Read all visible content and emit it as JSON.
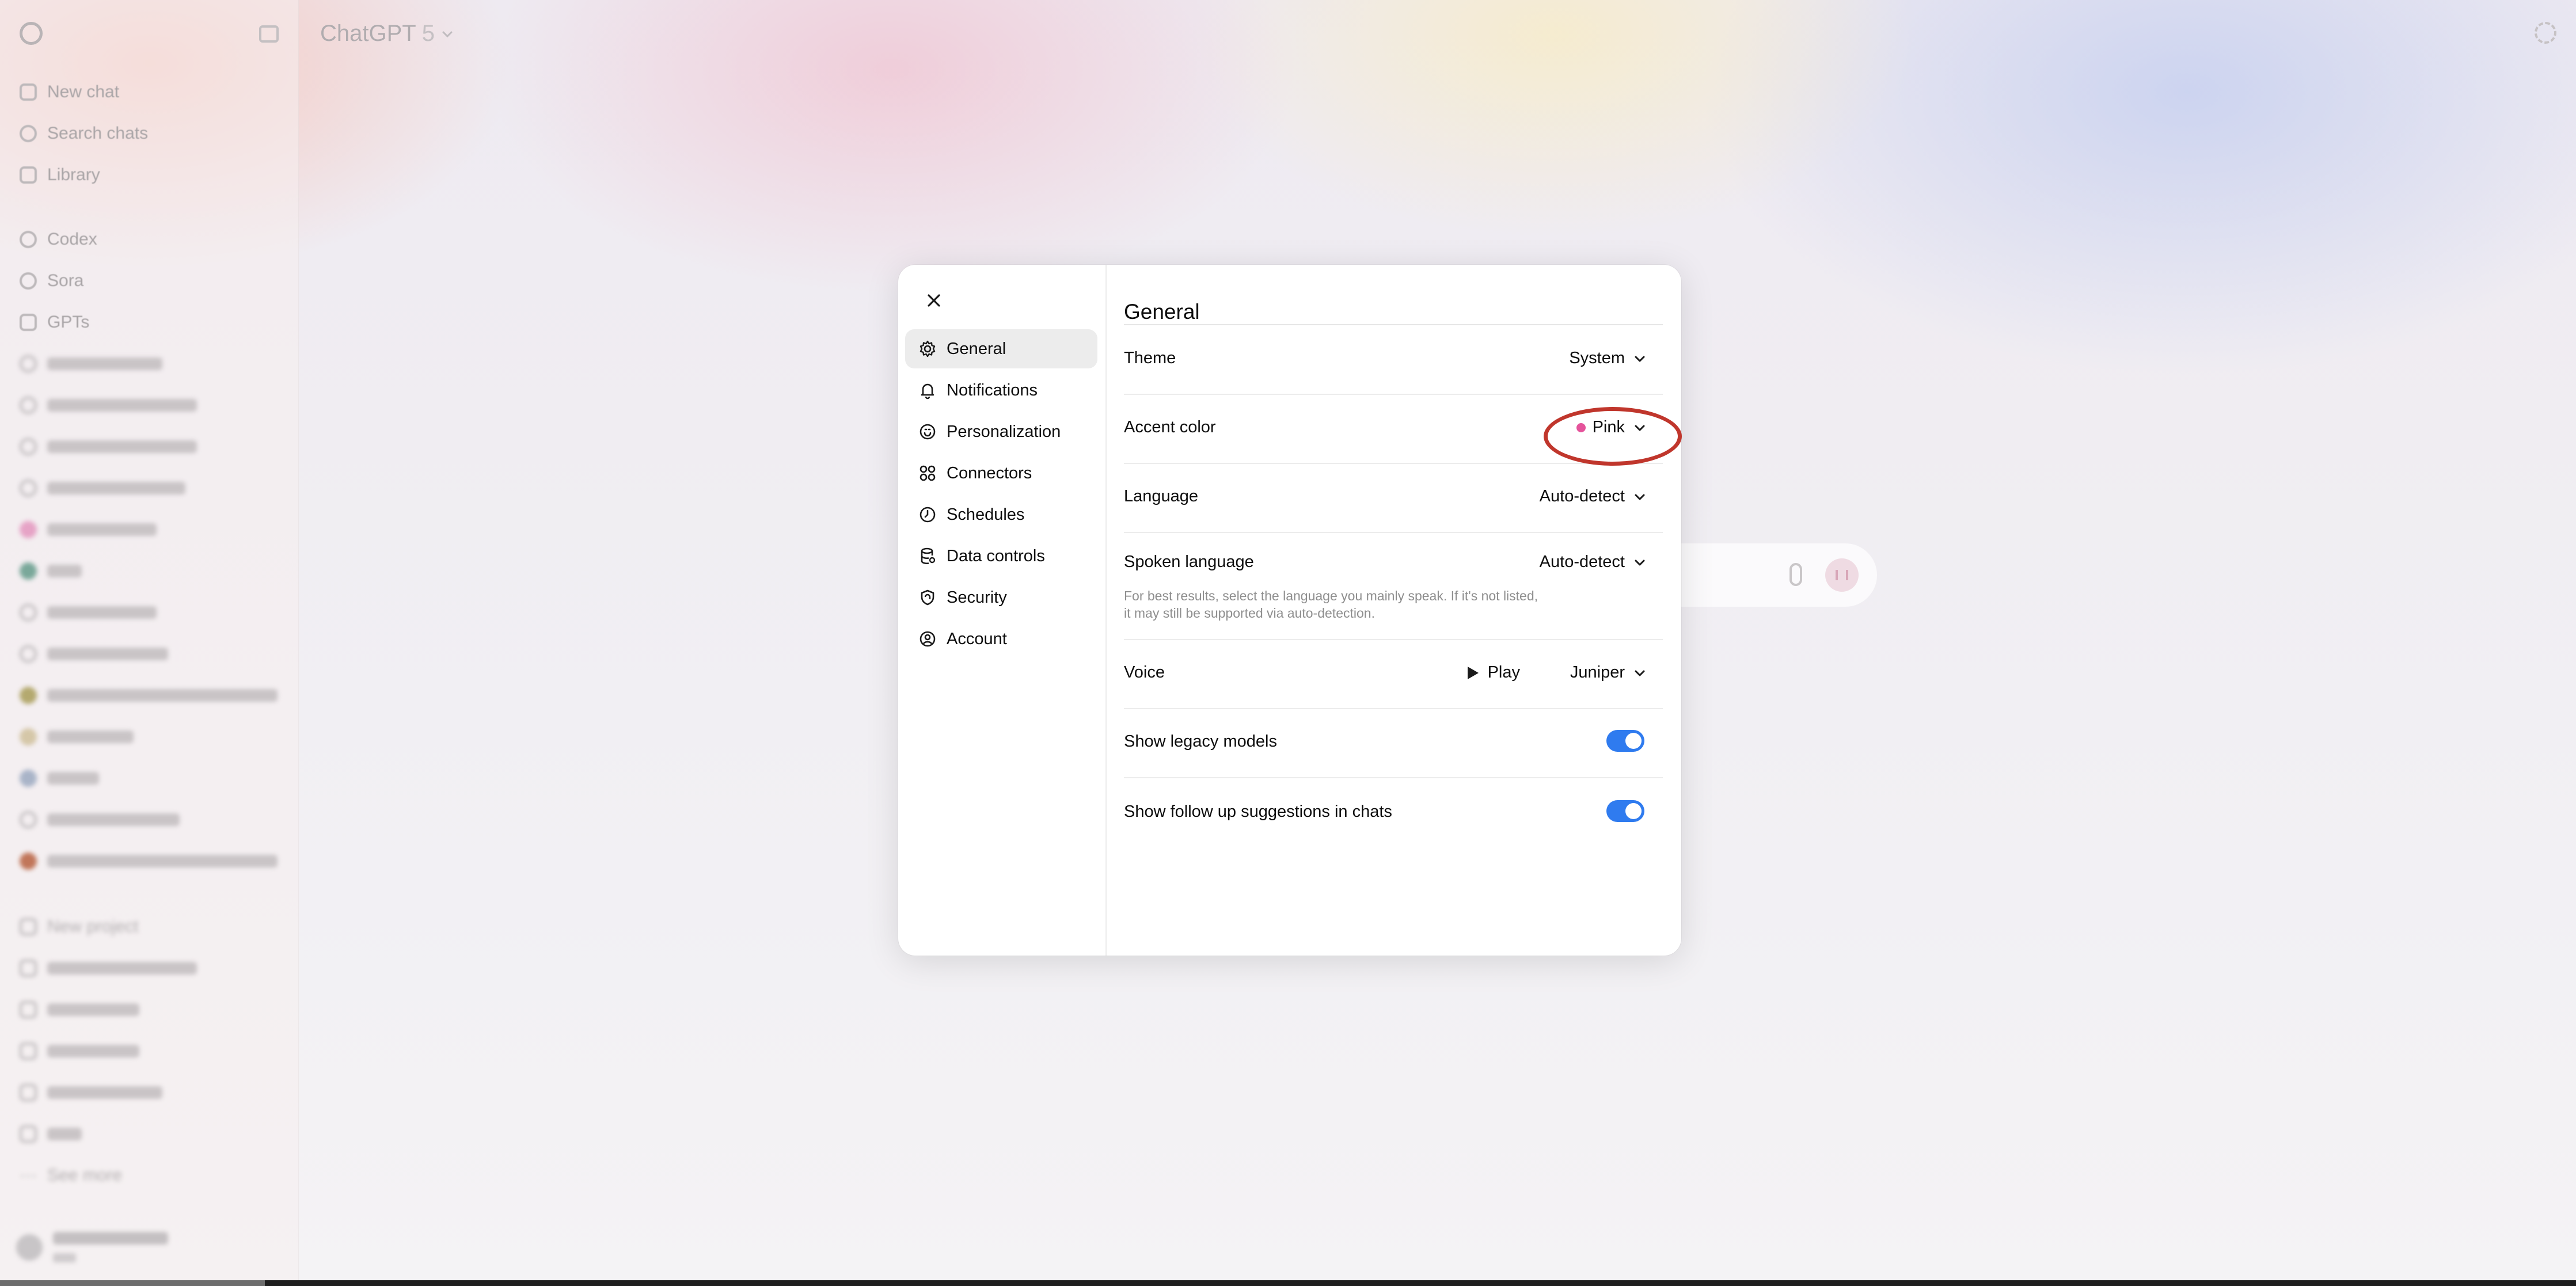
{
  "app": {
    "title": "ChatGPT",
    "model_version": "5"
  },
  "sidebar": {
    "primary": [
      {
        "label": "New chat",
        "icon": "edit-icon"
      },
      {
        "label": "Search chats",
        "icon": "search-icon"
      },
      {
        "label": "Library",
        "icon": "library-icon"
      }
    ],
    "secondary": [
      {
        "label": "Codex",
        "icon": "codex-icon"
      },
      {
        "label": "Sora",
        "icon": "sora-icon"
      },
      {
        "label": "GPTs",
        "icon": "grid-icon"
      }
    ],
    "projects_new_label": "New project",
    "see_more_label": "See more"
  },
  "settings": {
    "nav": [
      {
        "label": "General",
        "icon": "gear-icon",
        "active": true
      },
      {
        "label": "Notifications",
        "icon": "bell-icon"
      },
      {
        "label": "Personalization",
        "icon": "personalization-icon"
      },
      {
        "label": "Connectors",
        "icon": "connectors-icon"
      },
      {
        "label": "Schedules",
        "icon": "clock-icon"
      },
      {
        "label": "Data controls",
        "icon": "database-icon"
      },
      {
        "label": "Security",
        "icon": "shield-icon"
      },
      {
        "label": "Account",
        "icon": "user-circle-icon"
      }
    ],
    "title": "General",
    "theme": {
      "label": "Theme",
      "value": "System"
    },
    "accent_color": {
      "label": "Accent color",
      "value": "Pink",
      "swatch": "#e5539b"
    },
    "language": {
      "label": "Language",
      "value": "Auto-detect"
    },
    "spoken_language": {
      "label": "Spoken language",
      "value": "Auto-detect",
      "hint_line1": "For best results, select the language you mainly speak. If it's not listed,",
      "hint_line2": "it may still be supported via auto-detection."
    },
    "voice": {
      "label": "Voice",
      "play_label": "Play",
      "value": "Juniper"
    },
    "show_legacy_models": {
      "label": "Show legacy models",
      "enabled": true
    },
    "show_follow_up": {
      "label": "Show follow up suggestions in chats",
      "enabled": true
    }
  },
  "colors": {
    "toggle_on": "#2f7bef",
    "annotation": "#c0362c",
    "accent_pink": "#e5539b"
  }
}
